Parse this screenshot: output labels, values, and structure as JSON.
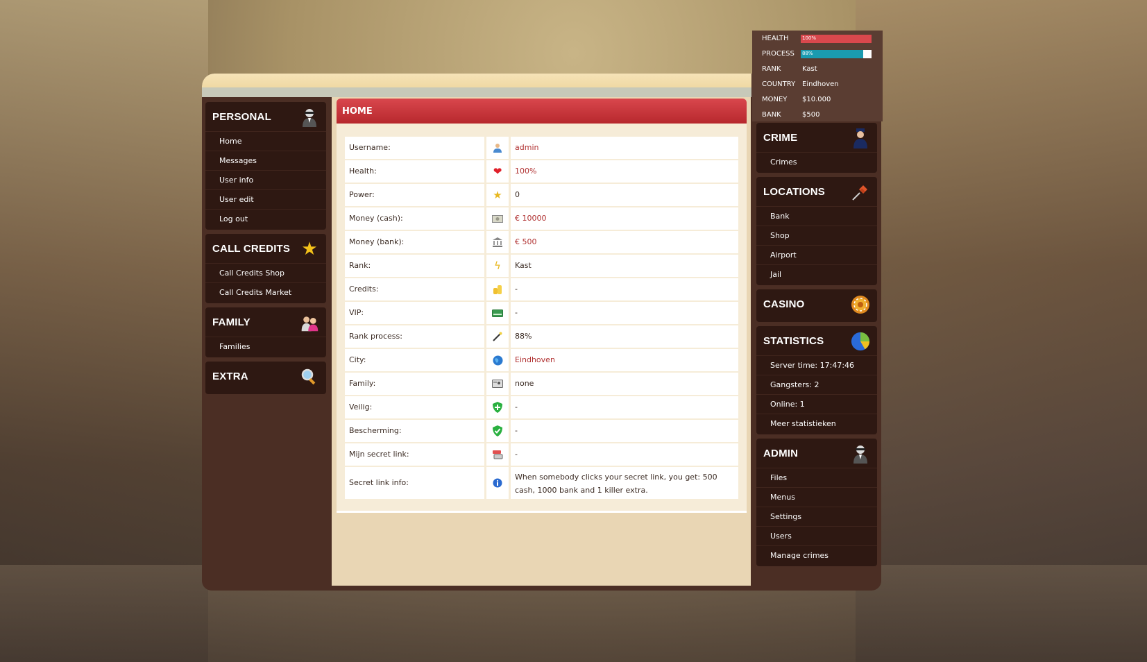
{
  "left": {
    "personal": {
      "title": "PERSONAL",
      "icon": "agent-icon",
      "items": [
        "Home",
        "Messages",
        "User info",
        "User edit",
        "Log out"
      ]
    },
    "call_credits": {
      "title": "CALL CREDITS",
      "icon": "star-icon",
      "items": [
        "Call Credits Shop",
        "Call Credits Market"
      ]
    },
    "family": {
      "title": "FAMILY",
      "icon": "family-icon",
      "items": [
        "Families"
      ]
    },
    "extra": {
      "title": "EXTRA",
      "icon": "magnifier-icon",
      "items": []
    }
  },
  "main": {
    "title": "HOME",
    "rows": [
      {
        "label": "Username:",
        "icon": "user-icon",
        "value": "admin",
        "red": true
      },
      {
        "label": "Health:",
        "icon": "heart-icon",
        "value": "100%",
        "red": true
      },
      {
        "label": "Power:",
        "icon": "star-icon",
        "value": "0",
        "red": false
      },
      {
        "label": "Money (cash):",
        "icon": "cash-icon",
        "value": "€ 10000",
        "red": true
      },
      {
        "label": "Money (bank):",
        "icon": "bank-icon",
        "value": "€ 500",
        "red": true
      },
      {
        "label": "Rank:",
        "icon": "lightning-icon",
        "value": "Kast",
        "red": false
      },
      {
        "label": "Credits:",
        "icon": "coins-icon",
        "value": "-",
        "red": false
      },
      {
        "label": "VIP:",
        "icon": "card-icon",
        "value": "-",
        "red": false
      },
      {
        "label": "Rank process:",
        "icon": "wand-icon",
        "value": "88%",
        "red": false
      },
      {
        "label": "City:",
        "icon": "globe-icon",
        "value": "Eindhoven",
        "red": true
      },
      {
        "label": "Family:",
        "icon": "family-card-icon",
        "value": "none",
        "red": false
      },
      {
        "label": "Veilig:",
        "icon": "shield-plus-icon",
        "value": "-",
        "red": false
      },
      {
        "label": "Bescherming:",
        "icon": "shield-check-icon",
        "value": "-",
        "red": false
      },
      {
        "label": "Mijn secret link:",
        "icon": "link-icon",
        "value": "-",
        "red": false
      },
      {
        "label": "Secret link info:",
        "icon": "info-icon",
        "value": "When somebody clicks your secret link, you get: 500 cash, 1000 bank and 1 killer extra.",
        "red": false
      }
    ]
  },
  "stats": {
    "health_label": "HEALTH",
    "health_value": "100%",
    "health_pct": 100,
    "health_color": "#d9484d",
    "process_label": "PROCESS",
    "process_value": "88%",
    "process_pct": 88,
    "process_color": "#1a9bb0",
    "rank_label": "RANK",
    "rank_value": "Kast",
    "country_label": "COUNTRY",
    "country_value": "Eindhoven",
    "money_label": "MONEY",
    "money_value": "$10.000",
    "bank_label": "BANK",
    "bank_value": "$500"
  },
  "right": {
    "crime": {
      "title": "CRIME",
      "icon": "police-icon",
      "items": [
        "Crimes"
      ]
    },
    "locations": {
      "title": "LOCATIONS",
      "icon": "pin-icon",
      "items": [
        "Bank",
        "Shop",
        "Airport",
        "Jail"
      ]
    },
    "casino": {
      "title": "CASINO",
      "icon": "casino-chip-icon",
      "items": []
    },
    "statistics": {
      "title": "STATISTICS",
      "icon": "pie-chart-icon",
      "items": [
        "Server time: 17:47:46",
        "Gangsters: 2",
        "Online: 1",
        "Meer statistieken"
      ]
    },
    "admin": {
      "title": "ADMIN",
      "icon": "agent-icon",
      "items": [
        "Files",
        "Menus",
        "Settings",
        "Users",
        "Manage crimes"
      ]
    }
  }
}
